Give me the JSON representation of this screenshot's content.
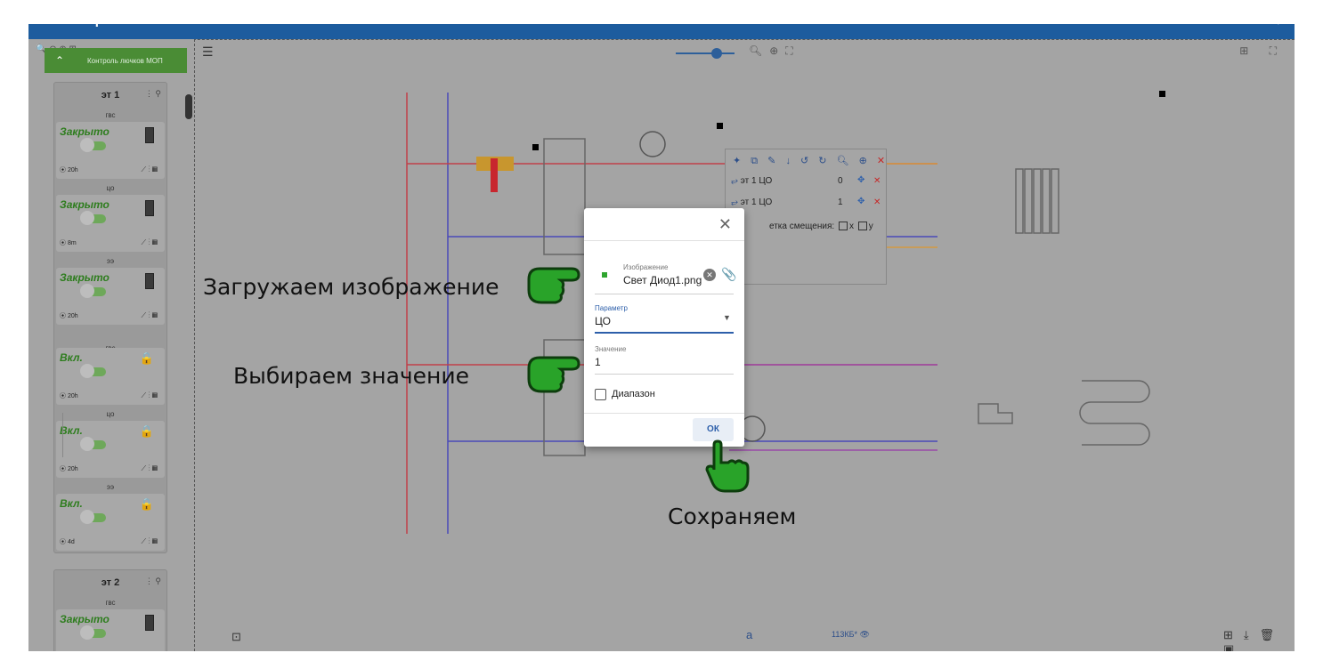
{
  "app": {
    "title": "Контроль лючков",
    "accent_color": "#1d5c9e",
    "panel_color": "#4a8c35"
  },
  "left_panel": {
    "header": "Контроль лючков МОП",
    "floors": [
      {
        "title": "эт 1",
        "cards": [
          {
            "label": "гвс",
            "state": "Закрыто",
            "time": "20h",
            "icon": "door-icon"
          },
          {
            "label": "цо",
            "state": "Закрыто",
            "time": "8m",
            "icon": "door-icon"
          },
          {
            "label": "ээ",
            "state": "Закрыто",
            "time": "20h",
            "icon": "door-icon"
          },
          {
            "label": "гвс",
            "state": "Вкл.",
            "time": "20h",
            "icon": "lock-icon"
          },
          {
            "label": "цо",
            "state": "Вкл.",
            "time": "20h",
            "icon": "lock-icon"
          },
          {
            "label": "ээ",
            "state": "Вкл.",
            "time": "4d",
            "icon": "lock-icon"
          }
        ]
      },
      {
        "title": "эт 2",
        "cards": [
          {
            "label": "гвс",
            "state": "Закрыто",
            "time": "",
            "icon": "door-icon"
          }
        ]
      }
    ]
  },
  "toolbar_popup": {
    "rows": [
      {
        "name": "эт 1 ЦО",
        "value": "0"
      },
      {
        "name": "эт 1 ЦО",
        "value": "1"
      }
    ],
    "grid_label": "етка смещения:",
    "grid_x": "x",
    "grid_y": "y"
  },
  "dialog": {
    "image_label": "Изображение",
    "image_value": "Свет Диод1.png",
    "param_label": "Параметр",
    "param_value": "ЦО",
    "value_label": "Значение",
    "value_value": "1",
    "range_label": "Диапазон",
    "ok_label": "ОК"
  },
  "annotations": {
    "load_image": "Загружаем изображение",
    "select_value": "Выбираем значение",
    "save": "Сохраняем"
  },
  "bottom_bar": {
    "layer": "a",
    "size": "113КБ*"
  }
}
